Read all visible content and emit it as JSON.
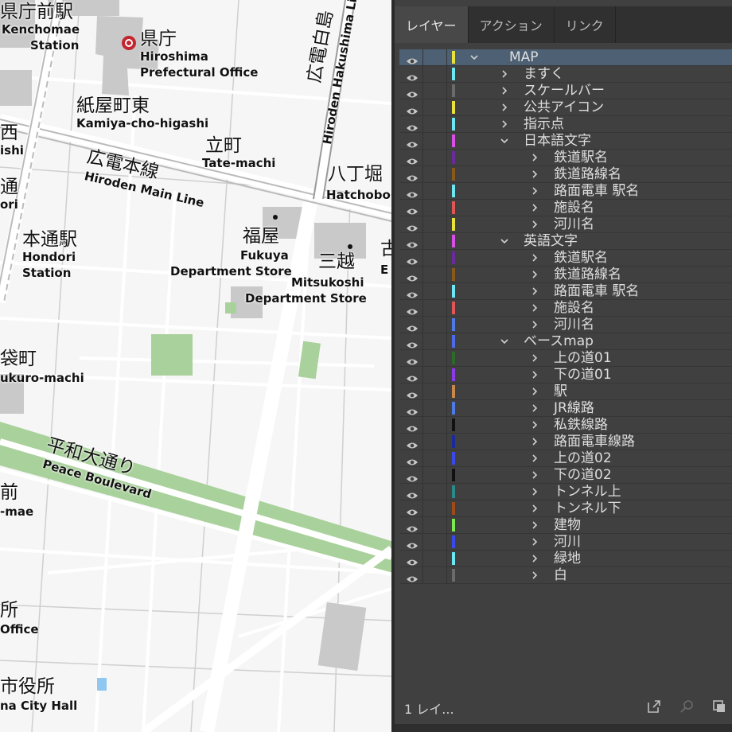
{
  "map": {
    "labels": {
      "kenchomae_jp": "県庁前駅",
      "kenchomae_en1": "Kenchomae",
      "kenchomae_en2": "Station",
      "kencho_jp": "県庁",
      "kencho_en1": "Hiroshima",
      "kencho_en2": "Prefectural Office",
      "kamiya_jp": "紙屋町東",
      "kamiya_en": "Kamiya-cho-higashi",
      "nishi_jp": "西",
      "nishi_en": "ishi",
      "tatemachi_jp": "立町",
      "tatemachi_en": "Tate-machi",
      "hiroden_jp": "広電本線",
      "hiroden_en": "Hiroden Main Line",
      "dori_jp": "通",
      "dori_en": "ori",
      "hatchobori_jp": "八丁堀",
      "hatchobori_en": "Hatchobo",
      "hondori_jp": "本通駅",
      "hondori_en1": "Hondori",
      "hondori_en2": "Station",
      "fukuya_jp": "福屋",
      "fukuya_en1": "Fukuya",
      "fukuya_en2": "Department Store",
      "mitsukoshi_jp": "三越",
      "mitsukoshi_en1": "Mitsukoshi",
      "mitsukoshi_en2": "Department Store",
      "e_cut_jp": "古",
      "e_cut_en": "E",
      "fukuromachi_jp": "袋町",
      "fukuromachi_en": "ukuro-machi",
      "heiwa_jp": "平和大通り",
      "heiwa_en": "Peace Boulevard",
      "mae_jp": "前",
      "mae_en": "-mae",
      "sho_jp": "所",
      "office_en": "Office",
      "shiyakusho_jp": "市役所",
      "cityhall_en": "na City Hall",
      "hakushima_jp": "広電白島",
      "hakushima_en": "Hiroden Hakushima Li"
    }
  },
  "panel": {
    "tabs": [
      {
        "label": "レイヤー",
        "active": true
      },
      {
        "label": "アクション",
        "active": false
      },
      {
        "label": "リンク",
        "active": false
      }
    ],
    "layers": [
      {
        "name": "MAP",
        "level": 0,
        "expanded": true,
        "color": "#e9e23a",
        "selected": true
      },
      {
        "name": "ますく",
        "level": 1,
        "expanded": false,
        "color": "#6ee7f2"
      },
      {
        "name": "スケールバー",
        "level": 1,
        "expanded": false,
        "color": "#6b6b6b"
      },
      {
        "name": "公共アイコン",
        "level": 1,
        "expanded": false,
        "color": "#e9e23a"
      },
      {
        "name": "指示点",
        "level": 1,
        "expanded": false,
        "color": "#6ee7f2"
      },
      {
        "name": "日本語文字",
        "level": 1,
        "expanded": true,
        "color": "#d84fe6"
      },
      {
        "name": "鉄道駅名",
        "level": 2,
        "expanded": false,
        "color": "#6a2a9a"
      },
      {
        "name": "鉄道路線名",
        "level": 2,
        "expanded": false,
        "color": "#8a5a1a"
      },
      {
        "name": "路面電車 駅名",
        "level": 2,
        "expanded": false,
        "color": "#6ee7f2"
      },
      {
        "name": "施設名",
        "level": 2,
        "expanded": false,
        "color": "#e05555"
      },
      {
        "name": "河川名",
        "level": 2,
        "expanded": false,
        "color": "#e9e23a"
      },
      {
        "name": "英語文字",
        "level": 1,
        "expanded": true,
        "color": "#d84fe6"
      },
      {
        "name": "鉄道駅名",
        "level": 2,
        "expanded": false,
        "color": "#6a2a9a"
      },
      {
        "name": "鉄道路線名",
        "level": 2,
        "expanded": false,
        "color": "#8a5a1a"
      },
      {
        "name": "路面電車 駅名",
        "level": 2,
        "expanded": false,
        "color": "#6ee7f2"
      },
      {
        "name": "施設名",
        "level": 2,
        "expanded": false,
        "color": "#e05555"
      },
      {
        "name": "河川名",
        "level": 2,
        "expanded": false,
        "color": "#4e7ae8"
      },
      {
        "name": "ベースmap",
        "level": 1,
        "expanded": true,
        "color": "#4e6ae8"
      },
      {
        "name": "上の道01",
        "level": 2,
        "expanded": false,
        "color": "#2e6a2a"
      },
      {
        "name": "下の道01",
        "level": 2,
        "expanded": false,
        "color": "#8a3ae8"
      },
      {
        "name": "駅",
        "level": 2,
        "expanded": false,
        "color": "#c88a4a"
      },
      {
        "name": "JR線路",
        "level": 2,
        "expanded": false,
        "color": "#4e7ae8"
      },
      {
        "name": "私鉄線路",
        "level": 2,
        "expanded": false,
        "color": "#111111"
      },
      {
        "name": "路面電車線路",
        "level": 2,
        "expanded": false,
        "color": "#1a2a9a"
      },
      {
        "name": "上の道02",
        "level": 2,
        "expanded": false,
        "color": "#3a4ae8"
      },
      {
        "name": "下の道02",
        "level": 2,
        "expanded": false,
        "color": "#111111"
      },
      {
        "name": "トンネル上",
        "level": 2,
        "expanded": false,
        "color": "#2a8a8a"
      },
      {
        "name": "トンネル下",
        "level": 2,
        "expanded": false,
        "color": "#a04a1a"
      },
      {
        "name": "建物",
        "level": 2,
        "expanded": false,
        "color": "#7ae84e"
      },
      {
        "name": "河川",
        "level": 2,
        "expanded": false,
        "color": "#3a4ae8"
      },
      {
        "name": "緑地",
        "level": 2,
        "expanded": false,
        "color": "#6ee7f2"
      },
      {
        "name": "白",
        "level": 2,
        "expanded": false,
        "color": "#6b6b6b"
      }
    ],
    "footer": {
      "count_label": "1 レイ..."
    }
  }
}
